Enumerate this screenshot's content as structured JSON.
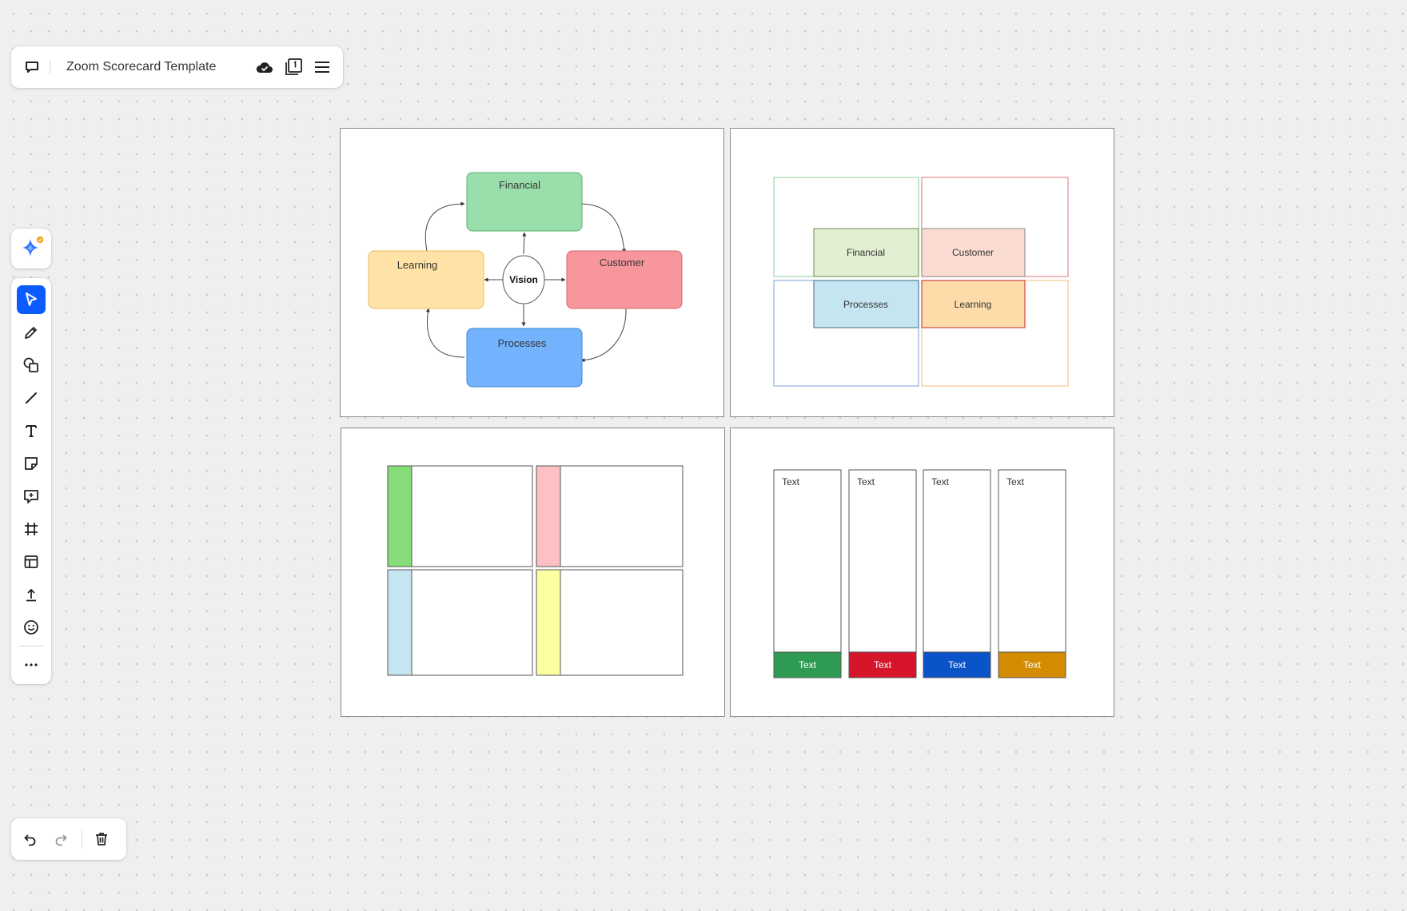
{
  "toolbar": {
    "title": "Zoom Scorecard Template"
  },
  "left_tools": [
    {
      "name": "select",
      "icon": "cursor-icon",
      "active": true
    },
    {
      "name": "pen",
      "icon": "pen-icon"
    },
    {
      "name": "shapes",
      "icon": "shapes-icon"
    },
    {
      "name": "line",
      "icon": "line-icon"
    },
    {
      "name": "text",
      "icon": "text-icon"
    },
    {
      "name": "sticky-note",
      "icon": "sticky-note-icon"
    },
    {
      "name": "comment",
      "icon": "comment-icon"
    },
    {
      "name": "frame",
      "icon": "frame-icon"
    },
    {
      "name": "templates",
      "icon": "template-icon"
    },
    {
      "name": "upload",
      "icon": "upload-icon"
    },
    {
      "name": "reactions",
      "icon": "emoji-icon"
    },
    {
      "name": "more",
      "icon": "more-icon"
    }
  ],
  "colors": {
    "accent": "#0b5cff",
    "financial": "#9adfab",
    "learning": "#ffe3a6",
    "customer": "#f8969d",
    "processes": "#73b3fd"
  },
  "frame1": {
    "financial": "Financial",
    "learning": "Learning",
    "vision": "Vision",
    "customer": "Customer",
    "processes": "Processes"
  },
  "frame2": {
    "financial": "Financial",
    "customer": "Customer",
    "processes": "Processes",
    "learning": "Learning"
  },
  "frame4": {
    "columns": [
      {
        "top": "Text",
        "bottom": "Text",
        "color": "#2e9a52"
      },
      {
        "top": "Text",
        "bottom": "Text",
        "color": "#d6142a"
      },
      {
        "top": "Text",
        "bottom": "Text",
        "color": "#0b53c9"
      },
      {
        "top": "Text",
        "bottom": "Text",
        "color": "#d48c02"
      }
    ]
  }
}
